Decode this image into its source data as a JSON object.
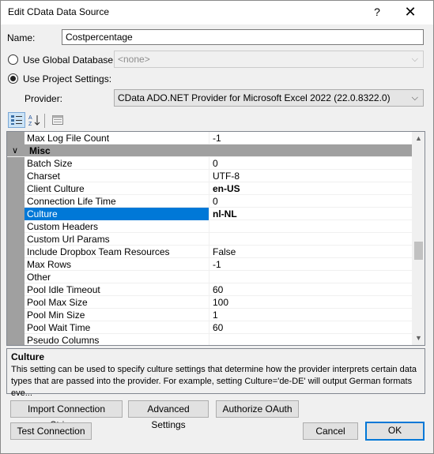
{
  "window": {
    "title": "Edit CData Data Source",
    "help": "?",
    "close": "✕"
  },
  "form": {
    "name_label": "Name:",
    "name_value": "Costpercentage",
    "global_db_label": "Use Global Database:",
    "global_db_value": "<none>",
    "project_settings_label": "Use Project Settings:",
    "provider_label": "Provider:",
    "provider_value": "CData ADO.NET Provider for Microsoft Excel 2022 (22.0.8322.0)"
  },
  "toolbar": {
    "categorized_icon": "categorized-icon",
    "alphabetical_icon": "sort-az-icon",
    "pages_icon": "property-pages-icon"
  },
  "grid": {
    "top_row": {
      "name": "Max Log File Count",
      "value": "-1"
    },
    "category": "Misc",
    "rows": [
      {
        "name": "Batch Size",
        "value": "0"
      },
      {
        "name": "Charset",
        "value": "UTF-8"
      },
      {
        "name": "Client Culture",
        "value": "en-US"
      },
      {
        "name": "Connection Life Time",
        "value": "0"
      },
      {
        "name": "Culture",
        "value": "nl-NL"
      },
      {
        "name": "Custom Headers",
        "value": ""
      },
      {
        "name": "Custom Url Params",
        "value": ""
      },
      {
        "name": "Include Dropbox Team Resources",
        "value": "False"
      },
      {
        "name": "Max Rows",
        "value": "-1"
      },
      {
        "name": "Other",
        "value": ""
      },
      {
        "name": "Pool Idle Timeout",
        "value": "60"
      },
      {
        "name": "Pool Max Size",
        "value": "100"
      },
      {
        "name": "Pool Min Size",
        "value": "1"
      },
      {
        "name": "Pool Wait Time",
        "value": "60"
      },
      {
        "name": "Pseudo Columns",
        "value": ""
      }
    ]
  },
  "description": {
    "title": "Culture",
    "text": "This setting can be used to specify culture settings that determine how the provider interprets certain data types that are passed into the provider. For example, setting Culture='de-DE' will output German formats eve..."
  },
  "buttons": {
    "import": "Import Connection String...",
    "advanced": "Advanced Settings",
    "oauth": "Authorize OAuth",
    "test": "Test Connection",
    "cancel": "Cancel",
    "ok": "OK"
  },
  "colors": {
    "selection": "#0078d7",
    "category_band": "#a0a0a0",
    "default_button_border": "#0078d7"
  }
}
